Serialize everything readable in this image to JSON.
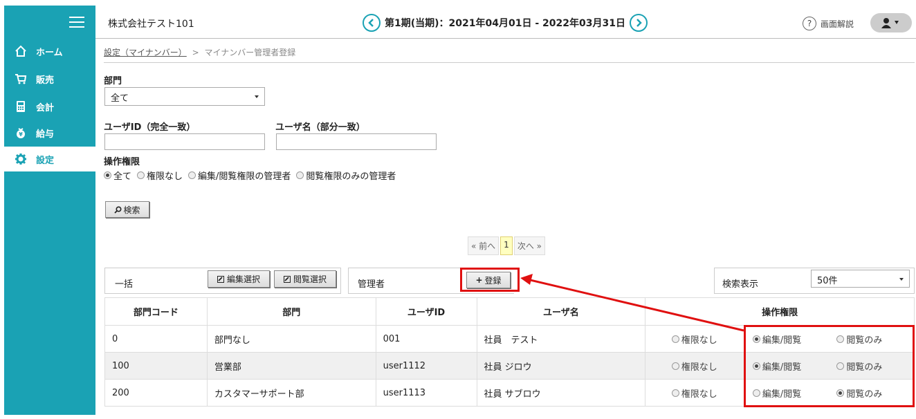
{
  "sidebar": {
    "items": [
      {
        "label": "ホーム",
        "icon": "home-icon"
      },
      {
        "label": "販売",
        "icon": "cart-icon"
      },
      {
        "label": "会計",
        "icon": "calculator-icon"
      },
      {
        "label": "給与",
        "icon": "money-bag-icon"
      },
      {
        "label": "設定",
        "icon": "gear-icon"
      }
    ]
  },
  "header": {
    "company": "株式会社テスト101",
    "period": "第1期(当期)：2021年04月01日 - 2022年03月31日",
    "help_label": "画面解説"
  },
  "breadcrumb": {
    "parent": "設定（マイナンバー）",
    "separator": ">",
    "current": "マイナンバー管理者登録"
  },
  "filters": {
    "department_label": "部門",
    "department_value": "全て",
    "userid_label": "ユーザID（完全一致）",
    "username_label": "ユーザ名（部分一致）",
    "permission_label": "操作権限",
    "permission_options": [
      "全て",
      "権限なし",
      "編集/閲覧権限の管理者",
      "閲覧権限のみの管理者"
    ],
    "search_button": "検索"
  },
  "pager": {
    "prev": "« 前へ",
    "current": "1",
    "next": "次へ »"
  },
  "toolbar": {
    "bulk_label": "一括",
    "edit_select": "編集選択",
    "view_select": "閲覧選択",
    "admin_label": "管理者",
    "register_button": "登録",
    "display_label": "検索表示",
    "display_value": "50件"
  },
  "table": {
    "headers": [
      "部門コード",
      "部門",
      "ユーザID",
      "ユーザ名",
      "操作権限"
    ],
    "perm_options": [
      "権限なし",
      "編集/閲覧",
      "閲覧のみ"
    ],
    "rows": [
      {
        "code": "0",
        "dept": "部門なし",
        "uid": "001",
        "name": "社員　テスト",
        "selected": 1
      },
      {
        "code": "100",
        "dept": "営業部",
        "uid": "user1112",
        "name": "社員 ジロウ",
        "selected": 1
      },
      {
        "code": "200",
        "dept": "カスタマーサポート部",
        "uid": "user1113",
        "name": "社員 サブロウ",
        "selected": 2
      }
    ]
  },
  "colors": {
    "accent": "#1aa2b4",
    "highlight": "#e01010"
  }
}
